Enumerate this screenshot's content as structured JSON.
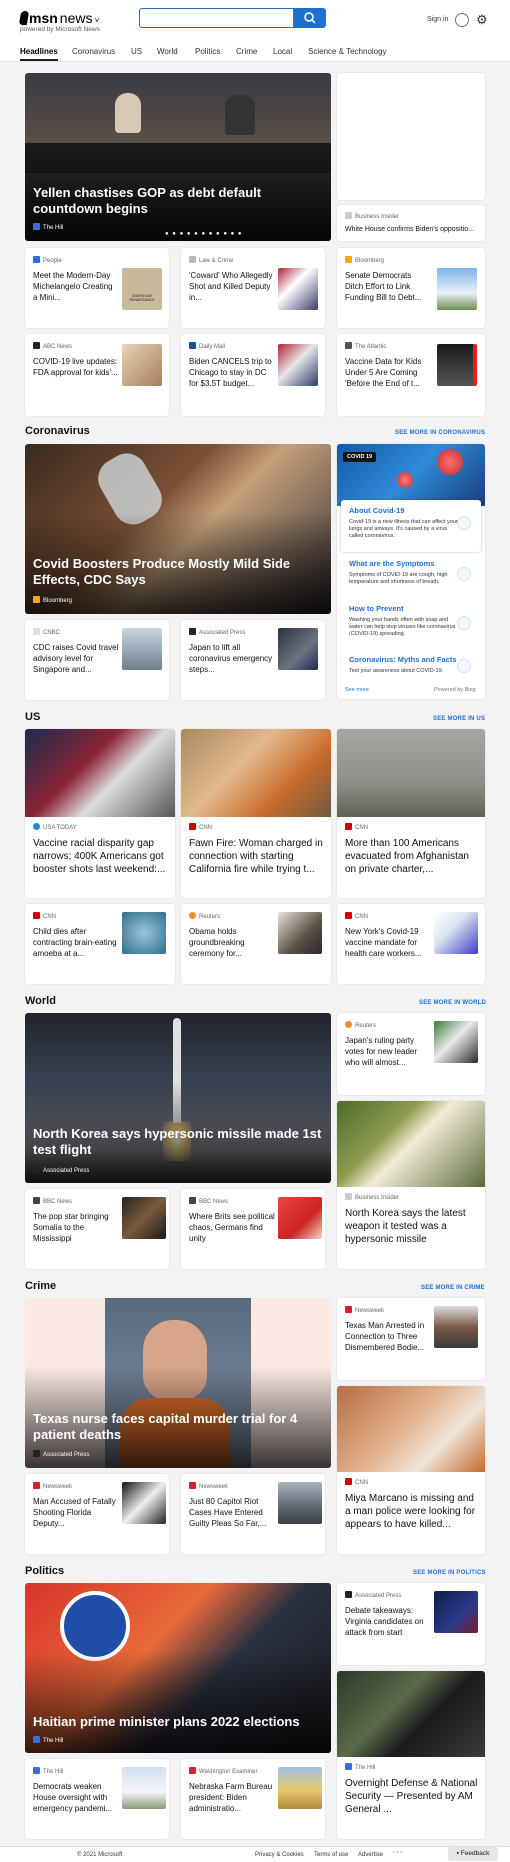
{
  "header": {
    "logo": "msn",
    "product": "news",
    "powered": "powered by Microsoft News",
    "search_value": "",
    "signin": "Sign in"
  },
  "nav": [
    "Headlines",
    "Coronavirus",
    "US",
    "World",
    "Politics",
    "Crime",
    "Local",
    "Science & Technology"
  ],
  "top": {
    "hero": {
      "title": "Yellen chastises GOP as debt default countdown begins",
      "source": "The Hill"
    },
    "side": {
      "source": "Business Insider",
      "title": "White House confirms Biden's oppositio..."
    },
    "cards": [
      {
        "source": "People",
        "title": "Meet the Modern-Day Michelangelo Creating a Mini...",
        "thumb_caption": "ODERN DAY RENAISSANCE"
      },
      {
        "source": "Law & Crime",
        "title": "'Coward' Who Allegedly Shot and Killed Deputy in..."
      },
      {
        "source": "Bloomberg",
        "title": "Senate Democrats Ditch Effort to Link Funding Bill to Debt..."
      },
      {
        "source": "ABC News",
        "title": "COVID-19 live updates: FDA approval for kids'..."
      },
      {
        "source": "Daily Mail",
        "title": "Biden CANCELS trip to Chicago to stay in DC for $3.5T budget..."
      },
      {
        "source": "The Atlantic",
        "title": "Vaccine Data for Kids Under 5 Are Coming 'Before the End of t..."
      }
    ]
  },
  "coronavirus": {
    "heading": "Coronavirus",
    "more": "SEE MORE IN CORONAVIRUS",
    "hero": {
      "title": "Covid Boosters Produce Mostly Mild Side Effects, CDC Says",
      "source": "Bloomberg"
    },
    "panel": {
      "badge": "COVID 19",
      "items": [
        {
          "title": "About Covid-19",
          "desc": "Covid-19 is a new illness that can affect your lungs and airways. It's caused by a virus called coronavirus."
        },
        {
          "title": "What are the Symptoms",
          "desc": "Symptoms of COVID-19 are cough, high temperature and shortness of breath."
        },
        {
          "title": "How to Prevent",
          "desc": "Washing your hands often with soap and water can help stop viruses like coronavirus (COVID-19) spreading."
        },
        {
          "title": "Coronavirus: Myths and Facts",
          "desc": "Test your awareness about COVID-19."
        }
      ],
      "see_more": "See more",
      "powered": "Powered by Bing"
    },
    "cards": [
      {
        "source": "CNBC",
        "title": "CDC raises Covid travel advisory level for Singapore and..."
      },
      {
        "source": "Associated Press",
        "title": "Japan to lift all coronavirus emergency steps..."
      }
    ]
  },
  "us": {
    "heading": "US",
    "more": "SEE MORE IN US",
    "big": [
      {
        "source": "USA TODAY",
        "title": "Vaccine racial disparity gap narrows; 400K Americans got booster shots last weekend:..."
      },
      {
        "source": "CNN",
        "title": "Fawn Fire: Woman charged in connection with starting California fire while trying t..."
      },
      {
        "source": "CNN",
        "title": "More than 100 Americans evacuated from Afghanistan on private charter,..."
      }
    ],
    "small": [
      {
        "source": "CNN",
        "title": "Child dies after contracting brain-eating amoeba at a..."
      },
      {
        "source": "Reuters",
        "title": "Obama holds groundbreaking ceremony for..."
      },
      {
        "source": "CNN",
        "title": "New York's Covid-19 vaccine mandate for health care workers..."
      }
    ]
  },
  "world": {
    "heading": "World",
    "more": "SEE MORE IN WORLD",
    "hero": {
      "title": "North Korea says hypersonic missile made 1st test flight",
      "source": "Associated Press"
    },
    "side1": {
      "source": "Reuters",
      "title": "Japan's ruling party votes for new leader who will almost..."
    },
    "side2": {
      "source": "Business Insider",
      "title": "North Korea says the latest weapon it tested was a hypersonic missile"
    },
    "cards": [
      {
        "source": "BBC News",
        "title": "The pop star bringing Somalia to the Mississippi"
      },
      {
        "source": "BBC News",
        "title": "Where Brits see political chaos, Germans find unity"
      }
    ]
  },
  "crime": {
    "heading": "Crime",
    "more": "SEE MORE IN CRIME",
    "hero": {
      "title": "Texas nurse faces capital murder trial for 4 patient deaths",
      "source": "Associated Press"
    },
    "side1": {
      "source": "Newsweek",
      "title": "Texas Man Arrested in Connection to Three Dismembered Bodie..."
    },
    "side2": {
      "source": "CNN",
      "title": "Miya Marcano is missing and a man police were looking for appears to have killed..."
    },
    "cards": [
      {
        "source": "Newsweek",
        "title": "Man Accused of Fatally Shooting Florida Deputy..."
      },
      {
        "source": "Newsweek",
        "title": "Just 80 Capitol Riot Cases Have Entered Guilty Pleas So Far,..."
      }
    ]
  },
  "politics": {
    "heading": "Politics",
    "more": "SEE MORE IN POLITICS",
    "hero": {
      "title": "Haitian prime minister plans 2022 elections",
      "source": "The Hill"
    },
    "side1": {
      "source": "Associated Press",
      "title": "Debate takeaways: Virginia candidates on attack from start"
    },
    "side2": {
      "source": "The Hill",
      "title": "Overnight Defense & National Security — Presented by AM General ..."
    },
    "cards": [
      {
        "source": "The Hill",
        "title": "Democrats weaken House oversight with emergency pandemi..."
      },
      {
        "source": "Washington Examiner",
        "title": "Nebraska Farm Bureau president: Biden administratio..."
      }
    ]
  },
  "footer": {
    "copyright": "© 2021 Microsoft",
    "privacy": "Privacy & Cookies",
    "terms": "Terms of use",
    "advertise": "Advertise",
    "more": "· · ·",
    "feedback": "Feedback"
  }
}
